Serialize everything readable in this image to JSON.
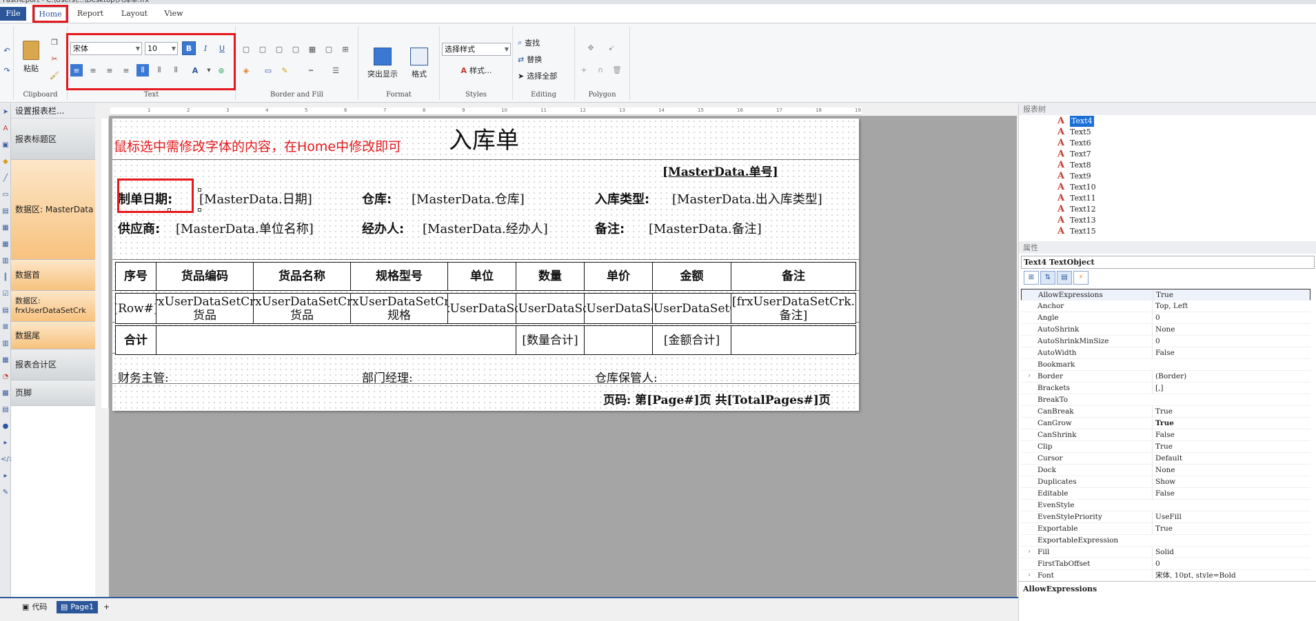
{
  "titlebar": {
    "text": "FastReport - C:\\Users\\...\\Desktop\\入库单.frx"
  },
  "menu": {
    "file": "File",
    "home": "Home",
    "report": "Report",
    "layout": "Layout",
    "view": "View"
  },
  "ribbon": {
    "clipboard": {
      "label": "Clipboard",
      "paste": "粘贴"
    },
    "text": {
      "label": "Text",
      "font": "宋体",
      "size": "10",
      "bold": "B",
      "italic": "I",
      "underline": "U"
    },
    "border_fill": {
      "label": "Border and Fill"
    },
    "format": {
      "label": "Format",
      "highlight": "突出显示",
      "format": "格式"
    },
    "styles": {
      "label": "Styles",
      "select_style": "选择样式",
      "style": "样式..."
    },
    "editing": {
      "label": "Editing",
      "find": "查找",
      "replace": "替换",
      "select_all": "选择全部"
    },
    "polygon": {
      "label": "Polygon"
    }
  },
  "bands_panel": {
    "header": "设置报表栏...",
    "bands": [
      {
        "label": "报表标题区"
      },
      {
        "label": "数据区: MasterData"
      },
      {
        "label": "数据首"
      },
      {
        "label": "数据区:\nfrxUserDataSetCrk"
      },
      {
        "label": "数据尾"
      },
      {
        "label": "报表合计区"
      },
      {
        "label": "页脚"
      }
    ]
  },
  "report": {
    "annotation": "鼠标选中需修改字体的内容，在Home中修改即可",
    "title": "入库单",
    "order_no": "[MasterData.单号]",
    "row1": {
      "date_label": "制单日期:",
      "date_value": "[MasterData.日期]",
      "wh_label": "仓库:",
      "wh_value": "[MasterData.仓库]",
      "type_label": "入库类型:",
      "type_value": "[MasterData.出入库类型]"
    },
    "row2": {
      "supplier_label": "供应商:",
      "supplier_value": "[MasterData.单位名称]",
      "handler_label": "经办人:",
      "handler_value": "[MasterData.经办人]",
      "note_label": "备注:",
      "note_value": "[MasterData.备注]"
    },
    "table_headers": [
      "序号",
      "货品编码",
      "货品名称",
      "规格型号",
      "单位",
      "数量",
      "单价",
      "金额",
      "备注"
    ],
    "table_data": [
      "[Row#]",
      "[frxUserDataSetCrk.货品",
      "[frxUserDataSetCrk.货品",
      "[frxUserDataSetCrk.规格",
      "[frxUserDataSetC",
      "[frxUserDataSetC",
      "[frxUserDataSetC",
      "[frxUserDataSetCrk",
      "[frxUserDataSetCrk.备注]"
    ],
    "footer_sum": {
      "label": "合计",
      "qty": "[数量合计]",
      "amount": "[金额合计]"
    },
    "sign": {
      "finance": "财务主管:",
      "dept": "部门经理:",
      "keeper": "仓库保管人:"
    },
    "page_footer": "页码: 第[Page#]页 共[TotalPages#]页"
  },
  "tree": {
    "header": "报表树",
    "nodes": [
      "Text4",
      "Text5",
      "Text6",
      "Text7",
      "Text8",
      "Text9",
      "Text10",
      "Text11",
      "Text12",
      "Text13",
      "Text15"
    ]
  },
  "properties": {
    "header": "属性",
    "object": "Text4 TextObject",
    "rows": [
      {
        "name": "AllowExpressions",
        "value": "True"
      },
      {
        "name": "Anchor",
        "value": "Top, Left"
      },
      {
        "name": "Angle",
        "value": "0"
      },
      {
        "name": "AutoShrink",
        "value": "None"
      },
      {
        "name": "AutoShrinkMinSize",
        "value": "0"
      },
      {
        "name": "AutoWidth",
        "value": "False"
      },
      {
        "name": "Bookmark",
        "value": ""
      },
      {
        "name": "Border",
        "value": "(Border)"
      },
      {
        "name": "Brackets",
        "value": "[,]"
      },
      {
        "name": "BreakTo",
        "value": ""
      },
      {
        "name": "CanBreak",
        "value": "True"
      },
      {
        "name": "CanGrow",
        "value": "True"
      },
      {
        "name": "CanShrink",
        "value": "False"
      },
      {
        "name": "Clip",
        "value": "True"
      },
      {
        "name": "Cursor",
        "value": "Default"
      },
      {
        "name": "Dock",
        "value": "None"
      },
      {
        "name": "Duplicates",
        "value": "Show"
      },
      {
        "name": "Editable",
        "value": "False"
      },
      {
        "name": "EvenStyle",
        "value": ""
      },
      {
        "name": "EvenStylePriority",
        "value": "UseFill"
      },
      {
        "name": "Exportable",
        "value": "True"
      },
      {
        "name": "ExportableExpression",
        "value": ""
      },
      {
        "name": "Fill",
        "value": "Solid"
      },
      {
        "name": "FirstTabOffset",
        "value": "0"
      },
      {
        "name": "Font",
        "value": "宋体, 10pt, style=Bold"
      }
    ],
    "description": "AllowExpressions"
  },
  "bottom_tabs": {
    "code": "代码",
    "page": "Page1",
    "add": "+"
  }
}
